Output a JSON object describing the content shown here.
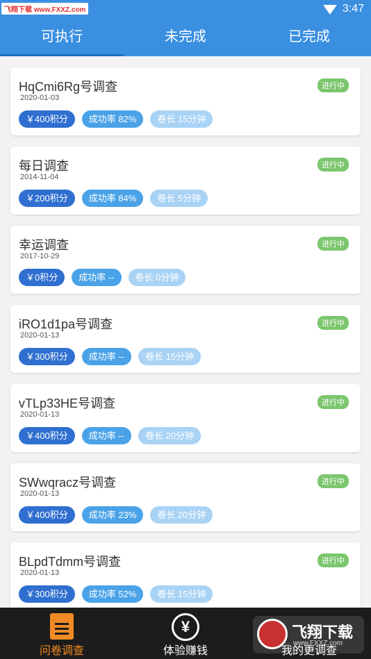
{
  "statusbar": {
    "watermark": "飞翔下载 www.FXXZ.com",
    "time": "3:47"
  },
  "tabs": [
    {
      "label": "可执行"
    },
    {
      "label": "未完成"
    },
    {
      "label": "已完成"
    }
  ],
  "cards": [
    {
      "title": "HqCmi6Rg号调查",
      "date": "2020-01-03",
      "status": "进行中",
      "points": "￥400积分",
      "rate": "成功率 82%",
      "length": "卷长 15分钟"
    },
    {
      "title": "每日调查",
      "date": "2014-11-04",
      "status": "进行中",
      "points": "￥200积分",
      "rate": "成功率 84%",
      "length": "卷长 5分钟"
    },
    {
      "title": "幸运调查",
      "date": "2017-10-29",
      "status": "进行中",
      "points": "￥0积分",
      "rate": "成功率 --",
      "length": "卷长 0分钟"
    },
    {
      "title": "iRO1d1pa号调查",
      "date": "2020-01-13",
      "status": "进行中",
      "points": "￥300积分",
      "rate": "成功率 --",
      "length": "卷长 15分钟"
    },
    {
      "title": "vTLp33HE号调查",
      "date": "2020-01-13",
      "status": "进行中",
      "points": "￥400积分",
      "rate": "成功率 --",
      "length": "卷长 20分钟"
    },
    {
      "title": "SWwqracz号调查",
      "date": "2020-01-13",
      "status": "进行中",
      "points": "￥400积分",
      "rate": "成功率 23%",
      "length": "卷长 20分钟"
    },
    {
      "title": "BLpdTdmm号调查",
      "date": "2020-01-13",
      "status": "进行中",
      "points": "￥300积分",
      "rate": "成功率 52%",
      "length": "卷长 15分钟"
    }
  ],
  "bottom_nav": [
    {
      "label": "问卷调查",
      "icon": "document-icon"
    },
    {
      "label": "体验赚钱",
      "icon": "yen-coin-icon"
    },
    {
      "label": "我的更调查",
      "icon": ""
    }
  ],
  "bottom_watermark": {
    "text": "飞翔下载",
    "url": "www.FXXZ.com"
  },
  "colors": {
    "primary": "#3a8fe0",
    "status_green": "#7cc66e",
    "accent_orange": "#f08a24"
  }
}
